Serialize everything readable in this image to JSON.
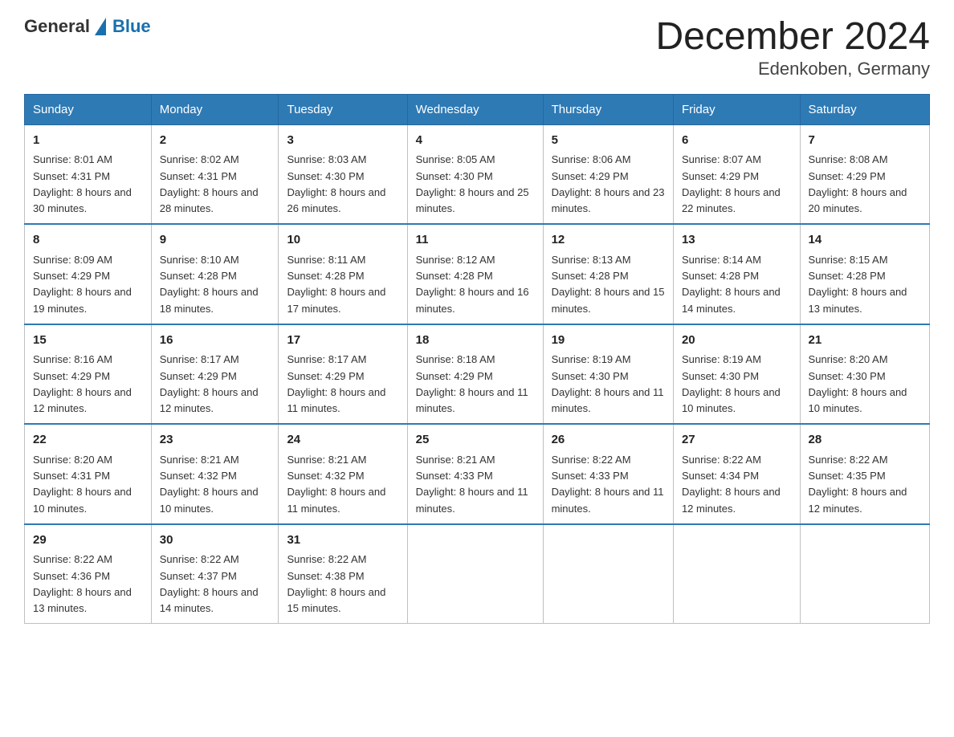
{
  "logo": {
    "text_general": "General",
    "text_blue": "Blue"
  },
  "title": "December 2024",
  "location": "Edenkoben, Germany",
  "days_of_week": [
    "Sunday",
    "Monday",
    "Tuesday",
    "Wednesday",
    "Thursday",
    "Friday",
    "Saturday"
  ],
  "weeks": [
    [
      {
        "num": "1",
        "sunrise": "Sunrise: 8:01 AM",
        "sunset": "Sunset: 4:31 PM",
        "daylight": "Daylight: 8 hours and 30 minutes."
      },
      {
        "num": "2",
        "sunrise": "Sunrise: 8:02 AM",
        "sunset": "Sunset: 4:31 PM",
        "daylight": "Daylight: 8 hours and 28 minutes."
      },
      {
        "num": "3",
        "sunrise": "Sunrise: 8:03 AM",
        "sunset": "Sunset: 4:30 PM",
        "daylight": "Daylight: 8 hours and 26 minutes."
      },
      {
        "num": "4",
        "sunrise": "Sunrise: 8:05 AM",
        "sunset": "Sunset: 4:30 PM",
        "daylight": "Daylight: 8 hours and 25 minutes."
      },
      {
        "num": "5",
        "sunrise": "Sunrise: 8:06 AM",
        "sunset": "Sunset: 4:29 PM",
        "daylight": "Daylight: 8 hours and 23 minutes."
      },
      {
        "num": "6",
        "sunrise": "Sunrise: 8:07 AM",
        "sunset": "Sunset: 4:29 PM",
        "daylight": "Daylight: 8 hours and 22 minutes."
      },
      {
        "num": "7",
        "sunrise": "Sunrise: 8:08 AM",
        "sunset": "Sunset: 4:29 PM",
        "daylight": "Daylight: 8 hours and 20 minutes."
      }
    ],
    [
      {
        "num": "8",
        "sunrise": "Sunrise: 8:09 AM",
        "sunset": "Sunset: 4:29 PM",
        "daylight": "Daylight: 8 hours and 19 minutes."
      },
      {
        "num": "9",
        "sunrise": "Sunrise: 8:10 AM",
        "sunset": "Sunset: 4:28 PM",
        "daylight": "Daylight: 8 hours and 18 minutes."
      },
      {
        "num": "10",
        "sunrise": "Sunrise: 8:11 AM",
        "sunset": "Sunset: 4:28 PM",
        "daylight": "Daylight: 8 hours and 17 minutes."
      },
      {
        "num": "11",
        "sunrise": "Sunrise: 8:12 AM",
        "sunset": "Sunset: 4:28 PM",
        "daylight": "Daylight: 8 hours and 16 minutes."
      },
      {
        "num": "12",
        "sunrise": "Sunrise: 8:13 AM",
        "sunset": "Sunset: 4:28 PM",
        "daylight": "Daylight: 8 hours and 15 minutes."
      },
      {
        "num": "13",
        "sunrise": "Sunrise: 8:14 AM",
        "sunset": "Sunset: 4:28 PM",
        "daylight": "Daylight: 8 hours and 14 minutes."
      },
      {
        "num": "14",
        "sunrise": "Sunrise: 8:15 AM",
        "sunset": "Sunset: 4:28 PM",
        "daylight": "Daylight: 8 hours and 13 minutes."
      }
    ],
    [
      {
        "num": "15",
        "sunrise": "Sunrise: 8:16 AM",
        "sunset": "Sunset: 4:29 PM",
        "daylight": "Daylight: 8 hours and 12 minutes."
      },
      {
        "num": "16",
        "sunrise": "Sunrise: 8:17 AM",
        "sunset": "Sunset: 4:29 PM",
        "daylight": "Daylight: 8 hours and 12 minutes."
      },
      {
        "num": "17",
        "sunrise": "Sunrise: 8:17 AM",
        "sunset": "Sunset: 4:29 PM",
        "daylight": "Daylight: 8 hours and 11 minutes."
      },
      {
        "num": "18",
        "sunrise": "Sunrise: 8:18 AM",
        "sunset": "Sunset: 4:29 PM",
        "daylight": "Daylight: 8 hours and 11 minutes."
      },
      {
        "num": "19",
        "sunrise": "Sunrise: 8:19 AM",
        "sunset": "Sunset: 4:30 PM",
        "daylight": "Daylight: 8 hours and 11 minutes."
      },
      {
        "num": "20",
        "sunrise": "Sunrise: 8:19 AM",
        "sunset": "Sunset: 4:30 PM",
        "daylight": "Daylight: 8 hours and 10 minutes."
      },
      {
        "num": "21",
        "sunrise": "Sunrise: 8:20 AM",
        "sunset": "Sunset: 4:30 PM",
        "daylight": "Daylight: 8 hours and 10 minutes."
      }
    ],
    [
      {
        "num": "22",
        "sunrise": "Sunrise: 8:20 AM",
        "sunset": "Sunset: 4:31 PM",
        "daylight": "Daylight: 8 hours and 10 minutes."
      },
      {
        "num": "23",
        "sunrise": "Sunrise: 8:21 AM",
        "sunset": "Sunset: 4:32 PM",
        "daylight": "Daylight: 8 hours and 10 minutes."
      },
      {
        "num": "24",
        "sunrise": "Sunrise: 8:21 AM",
        "sunset": "Sunset: 4:32 PM",
        "daylight": "Daylight: 8 hours and 11 minutes."
      },
      {
        "num": "25",
        "sunrise": "Sunrise: 8:21 AM",
        "sunset": "Sunset: 4:33 PM",
        "daylight": "Daylight: 8 hours and 11 minutes."
      },
      {
        "num": "26",
        "sunrise": "Sunrise: 8:22 AM",
        "sunset": "Sunset: 4:33 PM",
        "daylight": "Daylight: 8 hours and 11 minutes."
      },
      {
        "num": "27",
        "sunrise": "Sunrise: 8:22 AM",
        "sunset": "Sunset: 4:34 PM",
        "daylight": "Daylight: 8 hours and 12 minutes."
      },
      {
        "num": "28",
        "sunrise": "Sunrise: 8:22 AM",
        "sunset": "Sunset: 4:35 PM",
        "daylight": "Daylight: 8 hours and 12 minutes."
      }
    ],
    [
      {
        "num": "29",
        "sunrise": "Sunrise: 8:22 AM",
        "sunset": "Sunset: 4:36 PM",
        "daylight": "Daylight: 8 hours and 13 minutes."
      },
      {
        "num": "30",
        "sunrise": "Sunrise: 8:22 AM",
        "sunset": "Sunset: 4:37 PM",
        "daylight": "Daylight: 8 hours and 14 minutes."
      },
      {
        "num": "31",
        "sunrise": "Sunrise: 8:22 AM",
        "sunset": "Sunset: 4:38 PM",
        "daylight": "Daylight: 8 hours and 15 minutes."
      },
      {
        "num": "",
        "sunrise": "",
        "sunset": "",
        "daylight": ""
      },
      {
        "num": "",
        "sunrise": "",
        "sunset": "",
        "daylight": ""
      },
      {
        "num": "",
        "sunrise": "",
        "sunset": "",
        "daylight": ""
      },
      {
        "num": "",
        "sunrise": "",
        "sunset": "",
        "daylight": ""
      }
    ]
  ]
}
